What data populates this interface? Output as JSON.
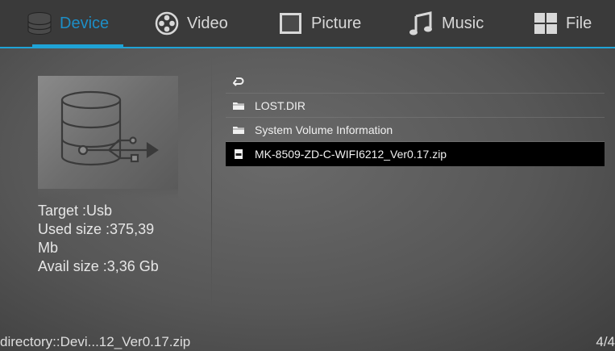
{
  "tabs": [
    {
      "label": "Device",
      "icon": "database-icon",
      "active": true
    },
    {
      "label": "Video",
      "icon": "film-reel-icon",
      "active": false
    },
    {
      "label": "Picture",
      "icon": "picture-frame-icon",
      "active": false
    },
    {
      "label": "Music",
      "icon": "music-note-icon",
      "active": false
    },
    {
      "label": "File",
      "icon": "grid-file-icon",
      "active": false
    }
  ],
  "accent_color": "#1fa3d6",
  "device": {
    "thumbnail_icon": "usb-database-icon",
    "target": "Target :Usb",
    "used_size_line1": "Used size :375,39",
    "used_size_line2": "Mb",
    "avail_size": "Avail size :3,36 Gb"
  },
  "files": [
    {
      "name": "",
      "icon": "back-arrow-icon",
      "selected": false
    },
    {
      "name": "LOST.DIR",
      "icon": "folder-icon",
      "selected": false
    },
    {
      "name": "System Volume Information",
      "icon": "folder-icon",
      "selected": false
    },
    {
      "name": "MK-8509-ZD-C-WIFI6212_Ver0.17.zip",
      "icon": "txt-file-icon",
      "selected": true
    }
  ],
  "status": {
    "path": "directory::Devi...12_Ver0.17.zip",
    "count": "4/4"
  }
}
